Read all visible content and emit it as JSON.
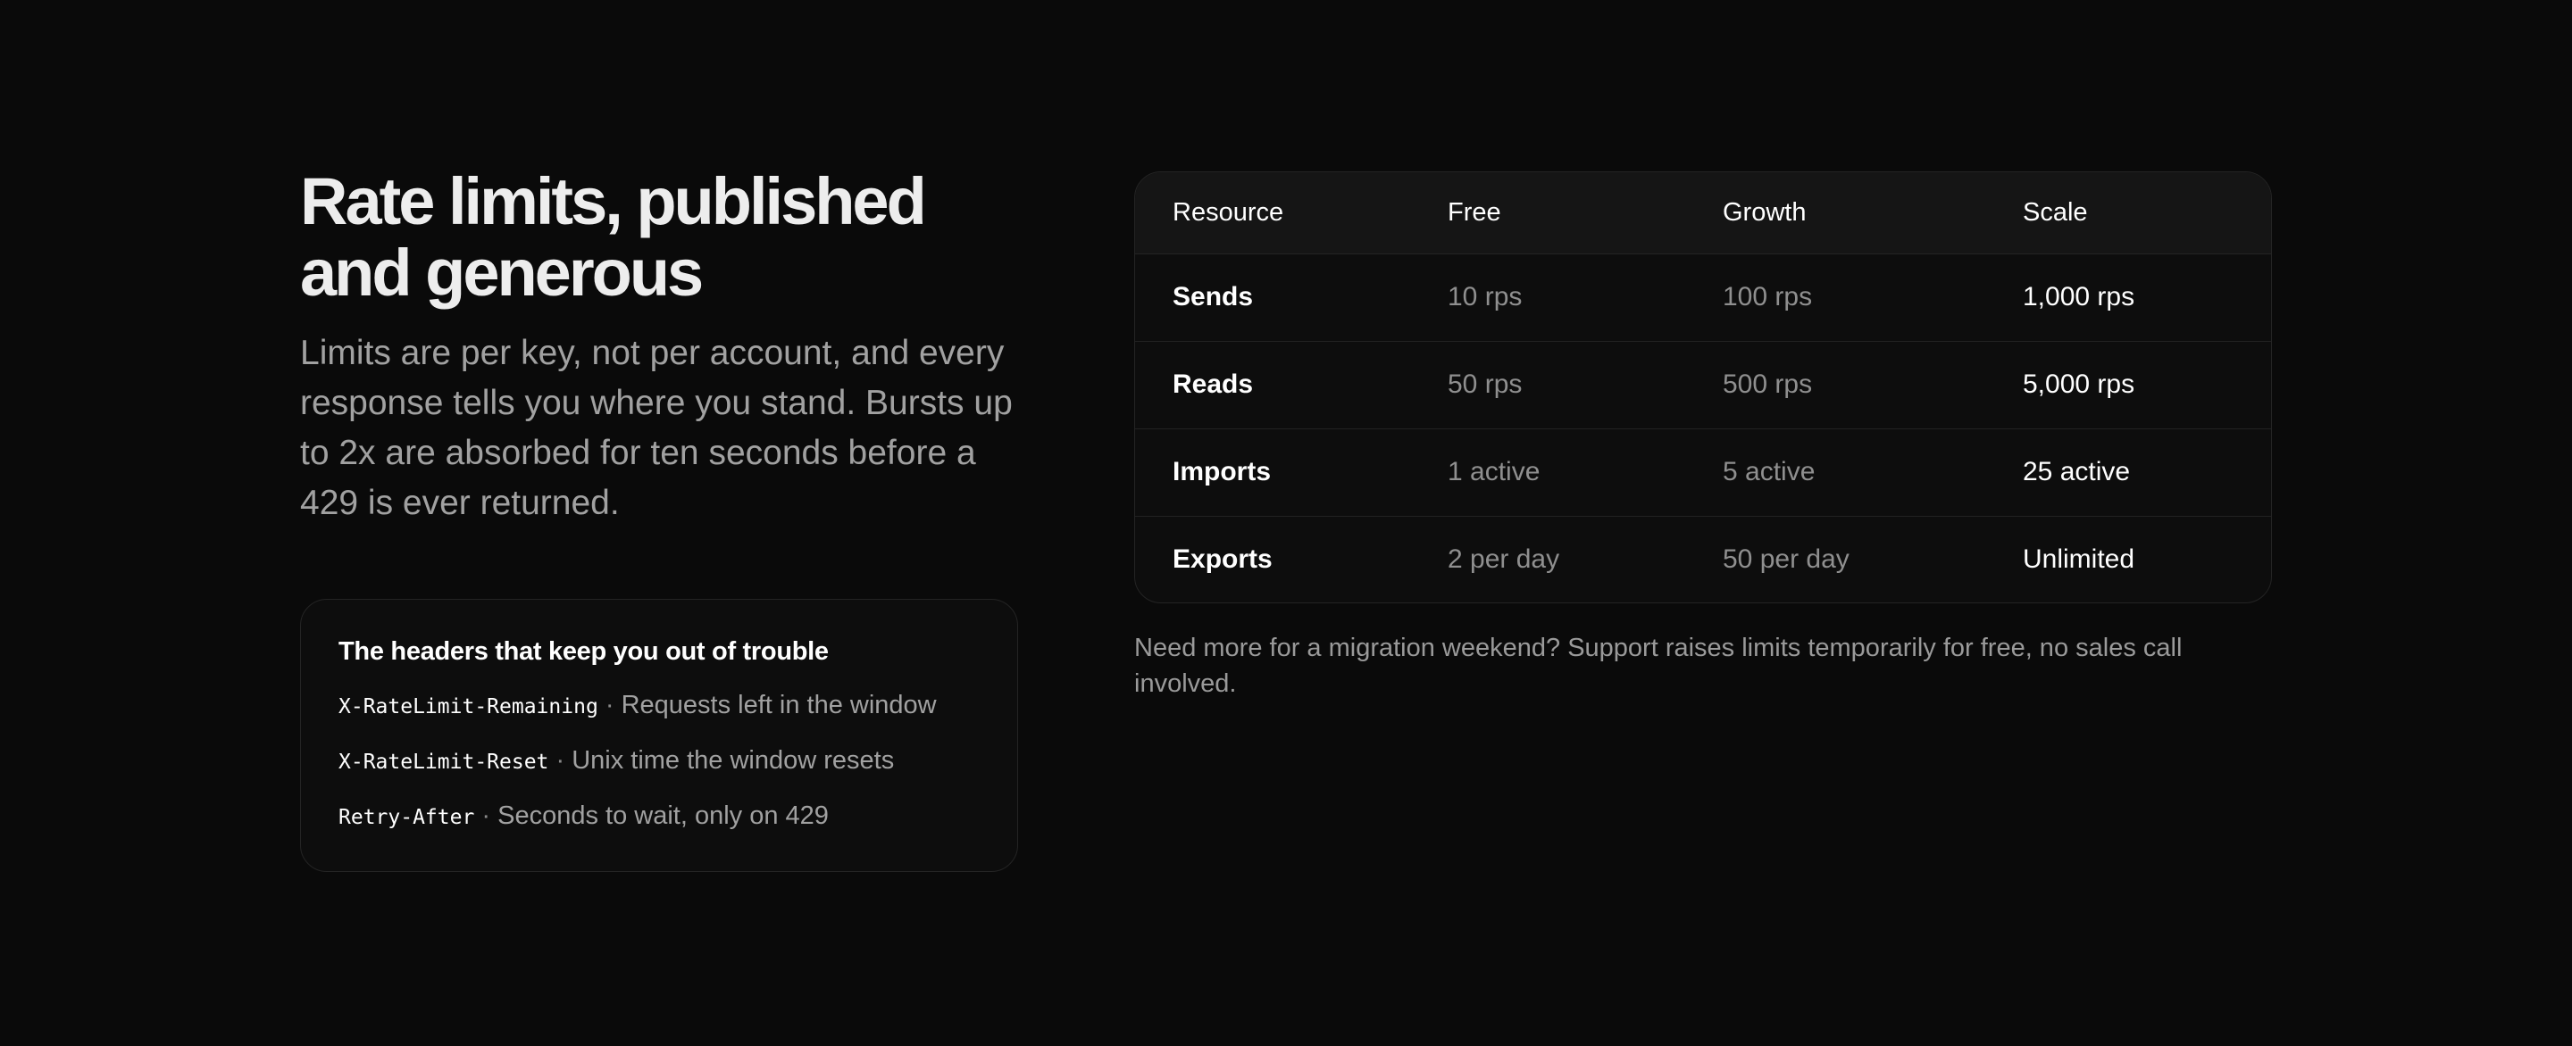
{
  "hero": {
    "title_line1": "Rate limits, published",
    "title_line2": "and generous",
    "description": "Limits are per key, not per account, and every response tells you where you stand. Bursts up to 2x are absorbed for ten seconds before a 429 is ever returned."
  },
  "headers_card": {
    "title": "The headers that keep you out of trouble",
    "separator": "·",
    "items": [
      {
        "name": "X-RateLimit-Remaining",
        "description": "Requests left in the window"
      },
      {
        "name": "X-RateLimit-Reset",
        "description": "Unix time the window resets"
      },
      {
        "name": "Retry-After",
        "description": "Seconds to wait, only on 429"
      }
    ]
  },
  "limits_table": {
    "columns": [
      "Resource",
      "Free",
      "Growth",
      "Scale"
    ],
    "rows": [
      [
        "Sends",
        "10 rps",
        "100 rps",
        "1,000 rps"
      ],
      [
        "Reads",
        "50 rps",
        "500 rps",
        "5,000 rps"
      ],
      [
        "Imports",
        "1 active",
        "5 active",
        "25 active"
      ],
      [
        "Exports",
        "2 per day",
        "50 per day",
        "Unlimited"
      ]
    ]
  },
  "note": "Need more for a migration weekend? Support raises limits temporarily for free, no sales call involved."
}
